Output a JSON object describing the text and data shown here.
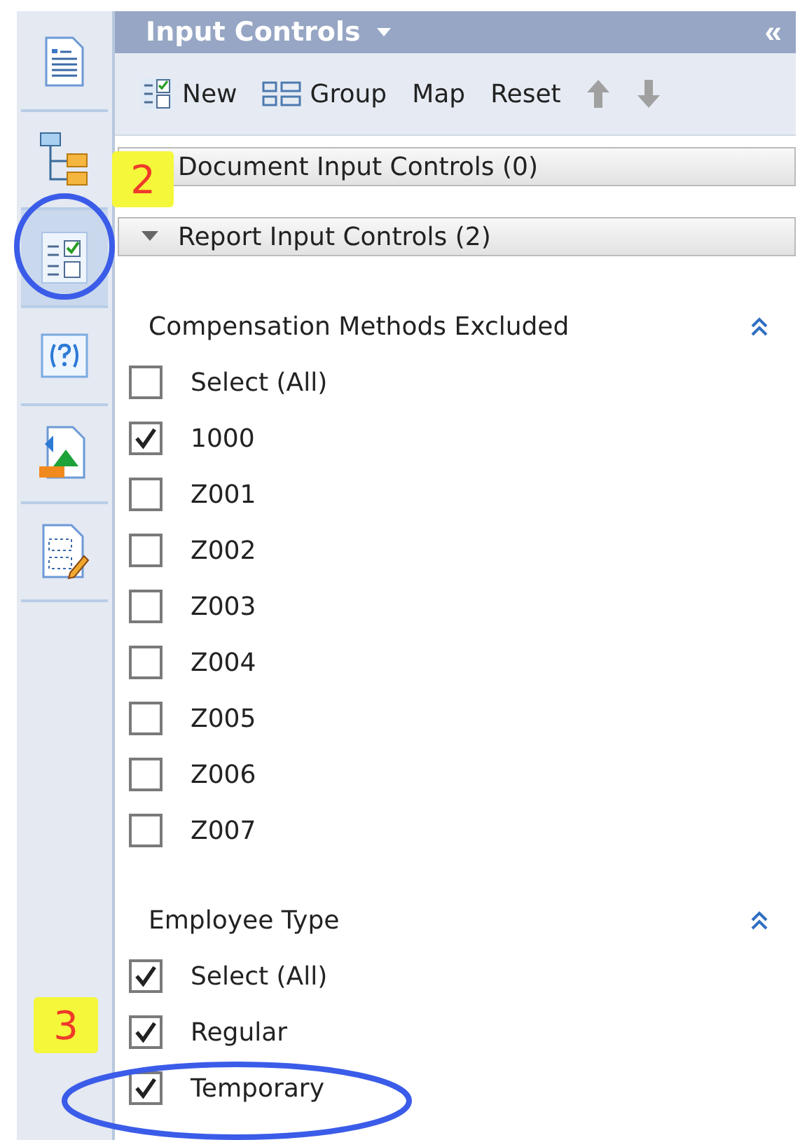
{
  "sidebar": {
    "items": [
      {
        "kind": "document",
        "selected": false
      },
      {
        "kind": "tree",
        "selected": false
      },
      {
        "kind": "controls",
        "selected": true
      },
      {
        "kind": "help",
        "selected": false
      },
      {
        "kind": "image",
        "selected": false
      },
      {
        "kind": "edit",
        "selected": false
      }
    ]
  },
  "panel": {
    "title": "Input Controls",
    "collapse_glyph": "«"
  },
  "toolbar": [
    {
      "label": "New",
      "kind": "new",
      "disabled": false
    },
    {
      "label": "Group",
      "kind": "group",
      "disabled": false
    },
    {
      "label": "Map",
      "kind": "text",
      "disabled": false
    },
    {
      "label": "Reset",
      "kind": "text",
      "disabled": false
    },
    {
      "kind": "up",
      "disabled": true
    },
    {
      "kind": "down",
      "disabled": true
    }
  ],
  "sections": [
    {
      "label": "Document Input Controls (0)"
    },
    {
      "label": "Report Input Controls (2)",
      "expanded": true
    }
  ],
  "controls": [
    {
      "title": "Compensation Methods Excluded",
      "items": [
        {
          "label": "Select (All)",
          "checked": false
        },
        {
          "label": "1000",
          "checked": true
        },
        {
          "label": "Z001",
          "checked": false
        },
        {
          "label": "Z002",
          "checked": false
        },
        {
          "label": "Z003",
          "checked": false
        },
        {
          "label": "Z004",
          "checked": false
        },
        {
          "label": "Z005",
          "checked": false
        },
        {
          "label": "Z006",
          "checked": false
        },
        {
          "label": "Z007",
          "checked": false
        }
      ]
    },
    {
      "title": "Employee Type",
      "items": [
        {
          "label": "Select (All)",
          "checked": true
        },
        {
          "label": "Regular",
          "checked": true
        },
        {
          "label": "Temporary",
          "checked": true
        }
      ]
    }
  ],
  "annotations": [
    {
      "label": "2"
    },
    {
      "label": "3"
    }
  ]
}
